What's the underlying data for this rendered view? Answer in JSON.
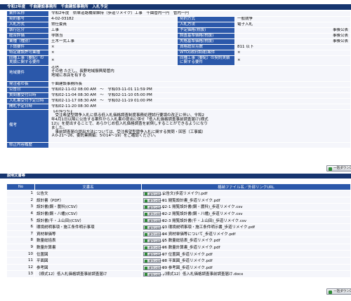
{
  "header": {
    "title": "令和2年度　千曲建設事務所　千曲建設事務所　入札予定"
  },
  "info_rows": [
    {
      "label": "案件名称",
      "value": "令和2年度　県単道路橋梁維持（歩道リメイク）工事　千曲管内一円　管内一円",
      "span": true
    },
    {
      "label": "契約番号",
      "value": "4-02-03182",
      "label2": "契約方式",
      "value2": "一般競争"
    },
    {
      "label": "入札方式",
      "value": "常任委員",
      "label2": "入札方法",
      "value2": "電子入札"
    },
    {
      "label": "執行区分",
      "value": "工事",
      "label2": "予定価格(税抜)",
      "value2": "",
      "tail2": "事後公表"
    },
    {
      "label": "総合評価",
      "value": "非該当",
      "label2": "調査基準価格(税抜)",
      "value2": "",
      "tail2": "事後公表"
    },
    {
      "label": "業種（種別）",
      "value": "土木一式工事",
      "label2": "失格基準価格(税抜)",
      "value2": "",
      "tail2": "事後公表"
    },
    {
      "label": "下請要件",
      "value": "×",
      "label2": "資格総合点数",
      "value2": "811 以下"
    },
    {
      "label": "特定建設許可業種",
      "value": "×",
      "label2": "WTO(政府調達)案件",
      "value2": "×"
    },
    {
      "label": "同種工事（要紀）の実績に関する要件",
      "value": "×",
      "label2": "同種工事（要紀）の契約実績に関する要件",
      "value2": "×",
      "tall": true
    },
    {
      "label": "地域要件",
      "value": "北信\nその他 ただし、長野地域振興局管内\n地域に本店を有する",
      "span": true,
      "tall3": true
    },
    {
      "label": "発注者の長",
      "value": "千曲建設事務所長",
      "span": true
    },
    {
      "label": "公告日",
      "value": "令和02-11-02 08:00 AM　～　令和03-11-01 11:59 PM",
      "span": true
    },
    {
      "label": "質問書受付日時",
      "value": "令和02-11-04 08:30 AM　～　令和02-11-10 05:00 PM",
      "span": true
    },
    {
      "label": "入札書受付予定日時",
      "value": "令和02-11-17 08:30 AM　～　令和02-11-19 01:00 PM",
      "span": true
    },
    {
      "label": "開札予定日時",
      "value": "令和02-11-20 08:30 AM",
      "span": true
    }
  ],
  "remarks": {
    "label": "備考",
    "lines": [
      "【お知らせ】",
      "　受注希望型競争入札に係る低入札価格調査制度事務処理試行要領の改正に伴い、令和2",
      "年4月1日以降に公告する案件から入札書の提出に併せ「低入札価格調査事前調査届け(様式",
      "12)」を提出することで、あらかじめ低入札価格調査を前倒しすることができるようになり",
      "ました。",
      "　事前調査届の提出方法については、受注希望型競争入札に関する質問・回答（工事編）",
      "Ａ0-21～26、委託業務編：5の14～19）をご確認ください。"
    ]
  },
  "correction": {
    "label": "修正内容履歴",
    "value": ""
  },
  "bulk_download_label": "一括ダウンロード",
  "docs_section_title": "説明文書等",
  "docs_table": {
    "headers": {
      "no": "No",
      "name": "文書名",
      "file": "格納ファイル名／外部リンクURL"
    },
    "download_label": "ダウンロード",
    "rows": [
      {
        "no": "1",
        "name": "公告文",
        "file": "公告文(歩道リメイク).pdf"
      },
      {
        "no": "2",
        "name": "設計書（PDF）",
        "file": "01 閲覧設計書_歩道リメイク.pdf"
      },
      {
        "no": "3",
        "name": "設計書(鋼・農科)(CSV）",
        "file": "02-1 閲覧設計書(鋼・農科)_歩道リメイク.csv"
      },
      {
        "no": "4",
        "name": "設計書(鋼・八幡)(CSV）",
        "file": "02-2 閲覧設計書(鋼・八幡)_歩道リメイク.csv"
      },
      {
        "no": "5",
        "name": "設計書(千・上山田)(CSV）",
        "file": "02-3 閲覧設計書(千・上山田)_歩道リメイク.csv"
      },
      {
        "no": "6",
        "name": "環境説明事項・施工条件明示事項",
        "file": "03 環境説明事項・施工条件明示書_歩道リメイク.pdf"
      },
      {
        "no": "7",
        "name": "資材単価等",
        "file": "04 資材単価等について_歩道リメイク.pdf"
      },
      {
        "no": "8",
        "name": "数量総括表",
        "file": "05 数量総括表_歩道リメイク.pdf"
      },
      {
        "no": "9",
        "name": "数量計算書",
        "file": "06 数量計算書_歩道リメイク.pdf"
      },
      {
        "no": "10",
        "name": "位置図",
        "file": "07 位置図_歩道リメイク.pdf"
      },
      {
        "no": "11",
        "name": "平面図",
        "file": "08 平面図_歩道リメイク.pdf"
      },
      {
        "no": "12",
        "name": "参考図",
        "file": "09 参考図_歩道リメイク.pdf"
      },
      {
        "no": "13",
        "name": "（様式12）低入札価格調査事前調査届け",
        "file": "（様式12）低入札価格調査事前調査届け.docx"
      }
    ]
  },
  "colors": {
    "header": "#16356f",
    "label": "#2b58aa",
    "cell": "#f5f6fb"
  }
}
